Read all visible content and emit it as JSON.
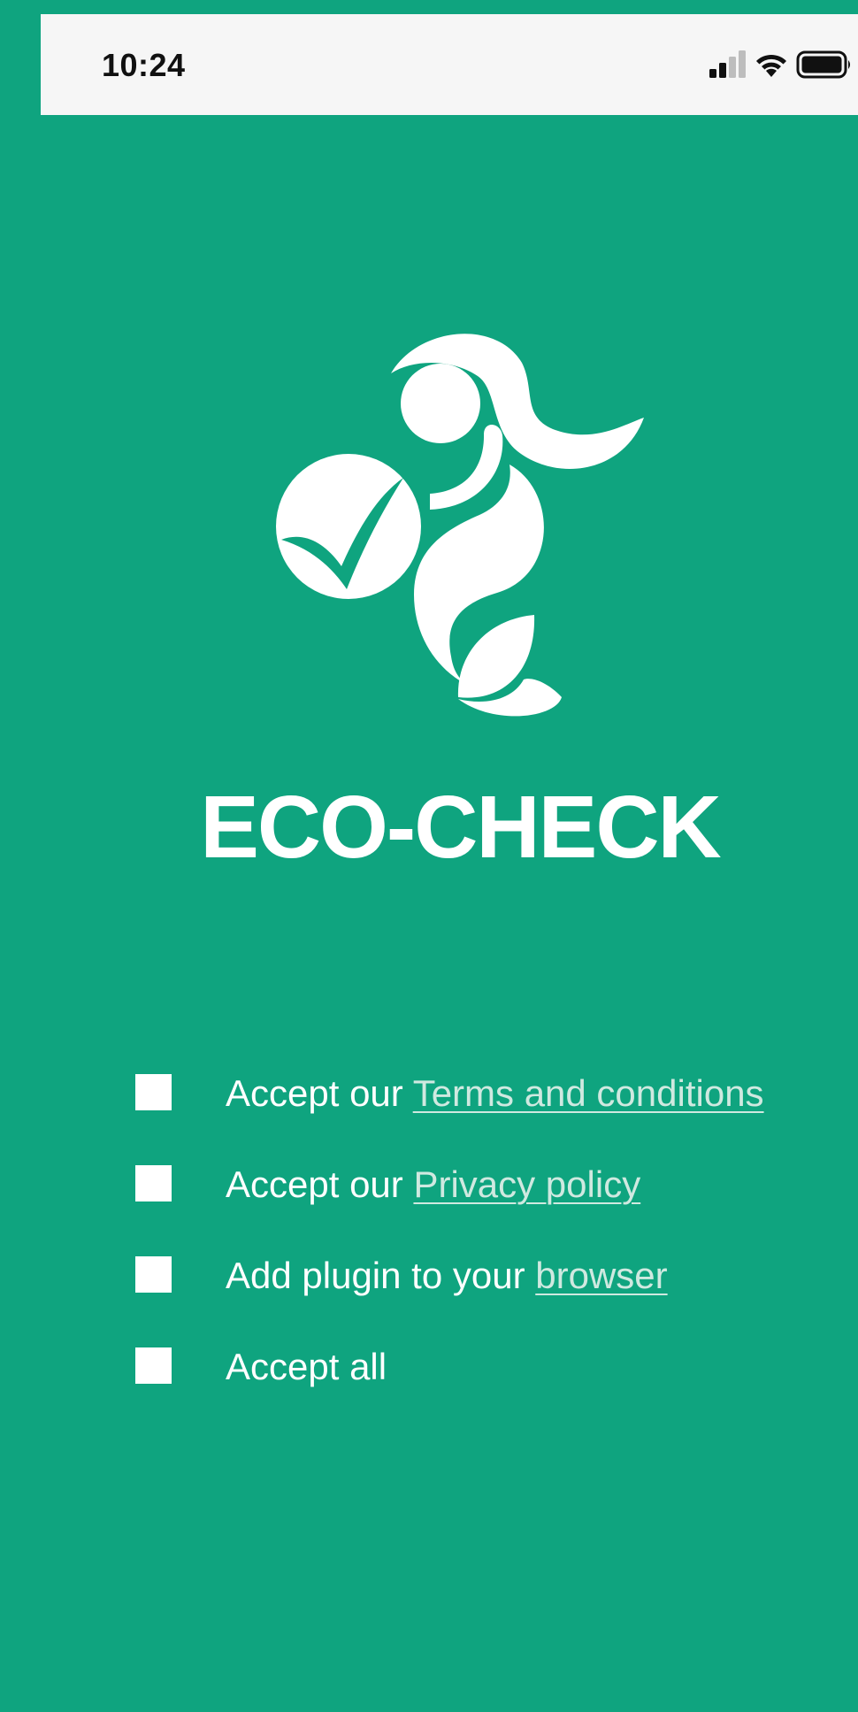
{
  "status_bar": {
    "time": "10:24",
    "icons": [
      "cellular-signal-icon",
      "wifi-icon",
      "battery-icon"
    ]
  },
  "app": {
    "logo": "eco-check-logo",
    "title": "ECO-CHECK"
  },
  "consents": [
    {
      "prefix": "Accept our ",
      "link": "Terms and conditions",
      "checked": false
    },
    {
      "prefix": "Accept our ",
      "link": "Privacy policy",
      "checked": false
    },
    {
      "prefix": "Add plugin to your ",
      "link": "browser",
      "checked": false
    },
    {
      "prefix": "Accept all",
      "link": "",
      "checked": false
    }
  ],
  "colors": {
    "background": "#0fa47f",
    "status_bar": "#f6f6f6",
    "foreground": "#ffffff",
    "link": "#cfe9e0"
  }
}
